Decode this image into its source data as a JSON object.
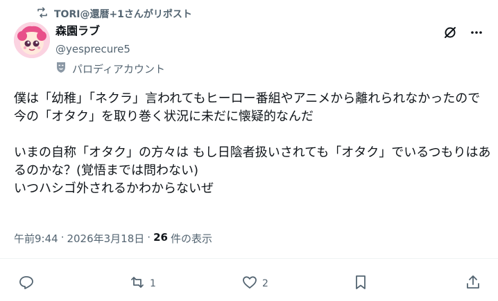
{
  "repost_banner": {
    "text": "TORI@還暦+1さんがリポスト",
    "icon": "repost-icon"
  },
  "author": {
    "display_name": "森園ラブ",
    "handle": "@yesprecure5",
    "label": "パロディアカウント",
    "label_icon": "mask-icon"
  },
  "top_actions": {
    "grok_icon": "grok-icon",
    "more_icon": "more-icon"
  },
  "tweet": {
    "text": "僕は「幼稚」「ネクラ」言われてもヒーロー番組やアニメから離れられなかったので 今の「オタク」を取り巻く状況に未だに懐疑的なんだ\n\nいまの自称「オタク」の方々は もし日陰者扱いされても「オタク」でいるつもりはあるのかな？(覚悟までは問わない)\nいつハシゴ外されるかわからないぜ"
  },
  "meta": {
    "time": "午前9:44",
    "separator1": "·",
    "date": "2026年3月18日",
    "separator2": "·",
    "views_count": "26",
    "views_label": "件の表示"
  },
  "actions": {
    "reply": {
      "icon": "reply-icon",
      "count": ""
    },
    "repost": {
      "icon": "repost-icon",
      "count": "1"
    },
    "like": {
      "icon": "heart-icon",
      "count": "2"
    },
    "bookmark": {
      "icon": "bookmark-icon",
      "count": ""
    },
    "share": {
      "icon": "share-icon",
      "count": ""
    }
  },
  "colors": {
    "text": "#0f1419",
    "secondary": "#536471",
    "divider": "#eff3f4"
  }
}
